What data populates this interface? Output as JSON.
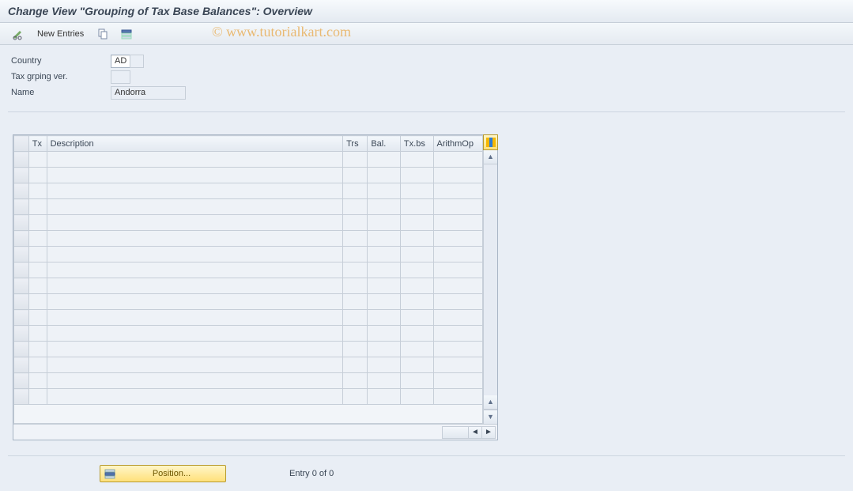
{
  "title": "Change View \"Grouping of Tax Base Balances\": Overview",
  "watermark": "© www.tutorialkart.com",
  "toolbar": {
    "new_entries": "New Entries"
  },
  "fields": {
    "country_label": "Country",
    "country_value": "AD",
    "tax_grp_label": "Tax grping ver.",
    "tax_grp_value": "",
    "name_label": "Name",
    "name_value": "Andorra"
  },
  "table": {
    "columns": {
      "tx": "Tx",
      "description": "Description",
      "trs": "Trs",
      "bal": "Bal.",
      "txbs": "Tx.bs",
      "arithmop": "ArithmOp"
    },
    "row_count": 16
  },
  "footer": {
    "position_btn": "Position...",
    "entry_text": "Entry 0 of 0"
  }
}
